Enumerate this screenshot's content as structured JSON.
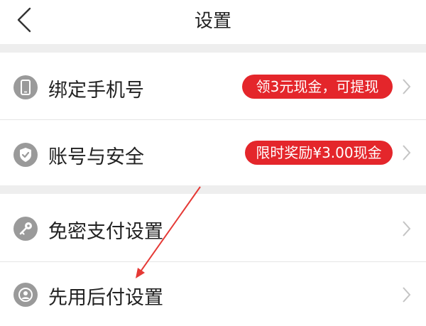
{
  "header": {
    "title": "设置"
  },
  "sections": [
    {
      "items": [
        {
          "label": "绑定手机号",
          "icon": "phone-icon",
          "badge": "领3元现金，可提现"
        },
        {
          "label": "账号与安全",
          "icon": "shield-check-icon",
          "badge": "限时奖励¥3.00现金"
        }
      ]
    },
    {
      "items": [
        {
          "label": "免密支付设置",
          "icon": "key-icon"
        },
        {
          "label": "先用后付设置",
          "icon": "pay-later-icon"
        }
      ]
    }
  ],
  "colors": {
    "badge_bg": "#e4262b",
    "icon_gray": "#9a9a9a",
    "section_gap": "#eeeeee",
    "annotation_arrow": "#e53935"
  }
}
